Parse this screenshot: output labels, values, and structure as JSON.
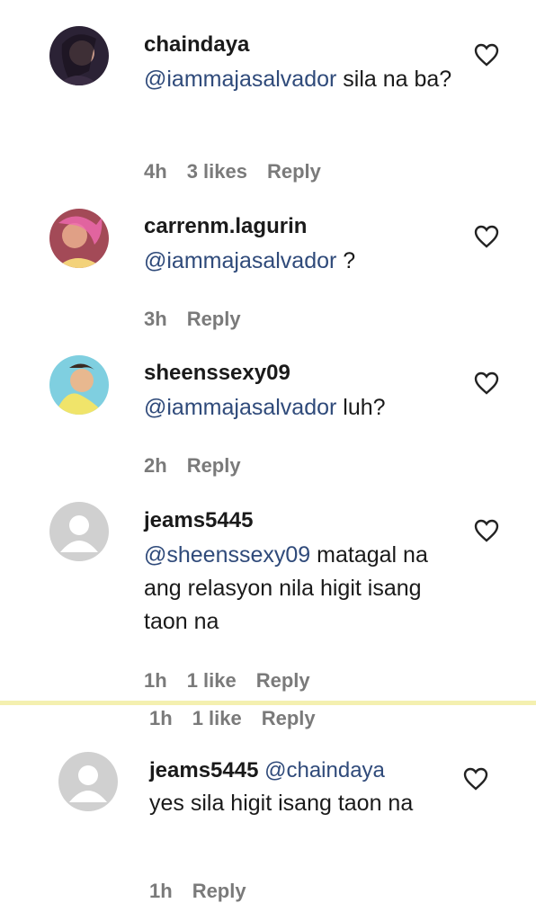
{
  "comments": [
    {
      "username": "chaindaya",
      "mention": "@iammajasalvador",
      "text": " sila na ba?",
      "time": "4h",
      "likes": "3 likes",
      "reply": "Reply"
    },
    {
      "username": "carrenm.lagurin",
      "mention": "@iammajasalvador",
      "text": " ?",
      "time": "3h",
      "likes": "",
      "reply": "Reply"
    },
    {
      "username": "sheenssexy09",
      "mention": "@iammajasalvador",
      "text": " luh?",
      "time": "2h",
      "likes": "",
      "reply": "Reply"
    },
    {
      "username": "jeams5445",
      "mention": "@sheenssexy09",
      "text": " matagal na ang relasyon nila higit isang taon na",
      "time": "1h",
      "likes": "1 like",
      "reply": "Reply"
    },
    {
      "username": "jeams5445",
      "mention": "@chaindaya",
      "text": "yes sila higit isang taon na",
      "time": "1h",
      "likes": "",
      "reply": "Reply"
    }
  ],
  "duplicate_meta": {
    "time": "1h",
    "likes": "1 like",
    "reply": "Reply"
  },
  "icons": {
    "like": "heart-outline-icon",
    "avatar_default": "default-avatar-icon"
  },
  "colors": {
    "mention": "#2f4a7a",
    "meta": "#7a7a7a",
    "divider": "#f4f0b0"
  }
}
